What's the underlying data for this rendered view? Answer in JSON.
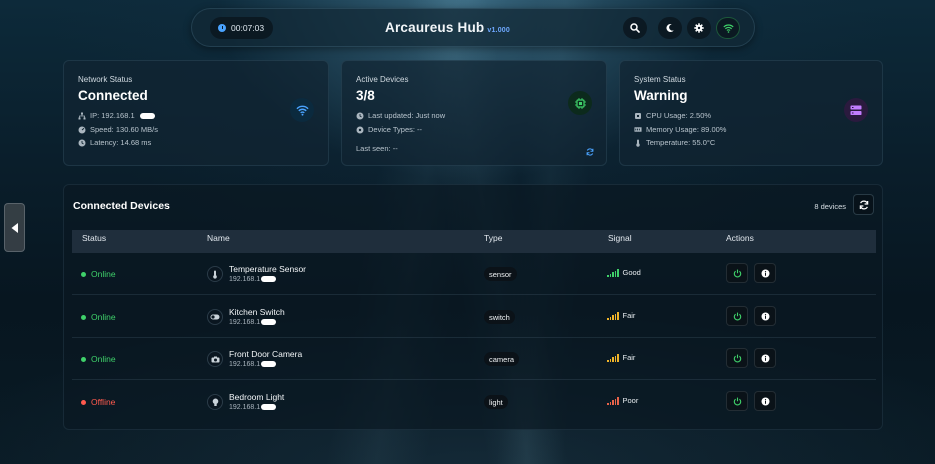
{
  "header": {
    "timer": "00:07:03",
    "title": "Arcaureus Hub",
    "version": "v1.000",
    "icons": [
      "search-icon",
      "moon-icon",
      "gear-icon",
      "wifi-icon"
    ]
  },
  "cards": {
    "network": {
      "label": "Network Status",
      "value": "Connected",
      "ip": "IP: 192.168.1",
      "speed": "Speed: 130.60 MB/s",
      "latency": "Latency: 14.68 ms",
      "icon": "wifi-icon"
    },
    "devices": {
      "label": "Active Devices",
      "value": "3/8",
      "last_updated": "Last updated: Just now",
      "device_types": "Device Types: --",
      "last_seen": "Last seen: --",
      "icon": "chip-icon"
    },
    "system": {
      "label": "System Status",
      "value": "Warning",
      "cpu": "CPU Usage: 2.50%",
      "memory": "Memory Usage: 89.00%",
      "temperature": "Temperature: 55.0°C",
      "icon": "server-icon"
    }
  },
  "devices_panel": {
    "title": "Connected Devices",
    "count": "8 devices",
    "columns": [
      "Status",
      "Name",
      "Type",
      "Signal",
      "Actions"
    ],
    "rows": [
      {
        "status": "Online",
        "name": "Temperature Sensor",
        "ip": "192.168.1",
        "type": "sensor",
        "signal": "Good",
        "icon": "thermometer-icon"
      },
      {
        "status": "Online",
        "name": "Kitchen Switch",
        "ip": "192.168.1",
        "type": "switch",
        "signal": "Fair",
        "icon": "toggle-icon"
      },
      {
        "status": "Online",
        "name": "Front Door Camera",
        "ip": "192.168.1",
        "type": "camera",
        "signal": "Fair",
        "icon": "camera-icon"
      },
      {
        "status": "Offline",
        "name": "Bedroom Light",
        "ip": "192.168.1",
        "type": "light",
        "signal": "Poor",
        "icon": "lightbulb-icon"
      }
    ]
  },
  "colors": {
    "online": "#3fd16a",
    "offline": "#ff5a4e",
    "good": "#3fd16a",
    "fair": "#f0b429",
    "poor": "#e8634a",
    "accent": "#4aa3ff",
    "power": "#3fd16a"
  }
}
